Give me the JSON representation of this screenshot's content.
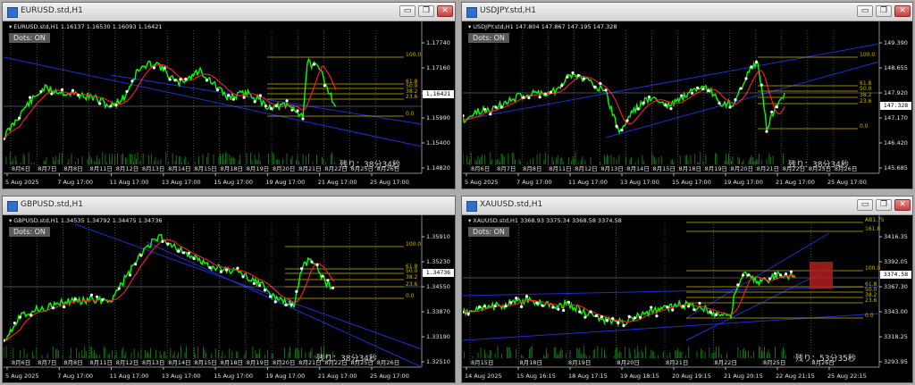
{
  "colors": {
    "candle_line": "#00ff00",
    "ma_line": "#ff2020",
    "trend_line": "#1c2fd6",
    "fib_line": "#c8b400",
    "dotted_grid": "#7a7a7a",
    "dots": "#ffffff"
  },
  "windows": [
    {
      "title": "EURUSD.std,H1",
      "info": "EURUSD.std,H1  1.16137 1.16530 1.16093 1.16421",
      "dots_label": "Dots: ON",
      "remaining": "残り：38分34秒",
      "price_current": "1.16421",
      "y_ticks": [
        "1.17740",
        "1.17160",
        "1.16570",
        "1.15990",
        "1.15400",
        "1.14820"
      ],
      "fib_labels": [
        "100.0",
        "61.8",
        "50.0",
        "38.2",
        "23.6",
        "0.0"
      ],
      "date_labels": [
        "8月6日",
        "8月7日",
        "8月8日",
        "8月11日",
        "8月12日",
        "8月13日",
        "8月14日",
        "8月15日",
        "8月18日",
        "8月19日",
        "8月20日",
        "8月21日",
        "8月22日",
        "8月25日",
        "8月26日"
      ],
      "x_ticks": [
        "5 Aug 2025",
        "7 Aug 17:00",
        "11 Aug 17:00",
        "13 Aug 17:00",
        "15 Aug 17:00",
        "19 Aug 17:00",
        "21 Aug 17:00",
        "25 Aug 17:00"
      ]
    },
    {
      "title": "USDJPY.std,H1",
      "info": "USDJPY.std,H1  147.804 147.867 147.195 147.328",
      "dots_label": "Dots: ON",
      "remaining": "残り：38分34秒",
      "price_current": "147.328",
      "y_ticks": [
        "149.390",
        "148.655",
        "147.920",
        "147.170",
        "146.420",
        "145.685"
      ],
      "fib_labels": [
        "100.0",
        "61.8",
        "50.0",
        "38.2",
        "23.6",
        "0.0"
      ],
      "date_labels": [
        "8月6日",
        "8月7日",
        "8月8日",
        "8月11日",
        "8月12日",
        "8月13日",
        "8月14日",
        "8月15日",
        "8月18日",
        "8月19日",
        "8月20日",
        "8月21日",
        "8月22日",
        "8月25日",
        "8月26日"
      ],
      "x_ticks": [
        "5 Aug 2025",
        "7 Aug 17:00",
        "11 Aug 17:00",
        "13 Aug 17:00",
        "15 Aug 17:00",
        "19 Aug 17:00",
        "21 Aug 17:00",
        "25 Aug 17:00"
      ]
    },
    {
      "title": "GBPUSD.std,H1",
      "info": "GBPUSD.std,H1  1.34535 1.34792 1.34475 1.34736",
      "dots_label": "Dots: ON",
      "remaining": "残り：38分34秒",
      "price_current": "1.34736",
      "y_ticks": [
        "1.35910",
        "1.35230",
        "1.34550",
        "1.33870",
        "1.33190",
        "1.32510"
      ],
      "fib_labels": [
        "100.0",
        "61.8",
        "50.0",
        "38.2",
        "23.6",
        "0.0"
      ],
      "date_labels": [
        "8月6日",
        "8月7日",
        "8月8日",
        "8月11日",
        "8月12日",
        "8月13日",
        "8月14日",
        "8月15日",
        "8月18日",
        "8月19日",
        "8月20日",
        "8月21日",
        "8月22日",
        "8月25日",
        "8月26日"
      ],
      "x_ticks": [
        "5 Aug 2025",
        "7 Aug 17:00",
        "11 Aug 17:00",
        "13 Aug 17:00",
        "15 Aug 17:00",
        "19 Aug 17:00",
        "21 Aug 17:00",
        "25 Aug 17:00"
      ]
    },
    {
      "title": "XAUUSD.std,H1",
      "info": "XAUUSD.std,H1  3368.93 3375.34 3368.58 3374.58",
      "dots_label": "Dots: ON",
      "remaining": "残り：53分35秒",
      "price_current": "3374.58",
      "y_ticks": [
        "3416.35",
        "3392.05",
        "3367.30",
        "3343.00",
        "3318.25",
        "3293.95"
      ],
      "fib_labels": [
        "AB1.75",
        "161.8",
        "100.0",
        "61.8",
        "50.0",
        "38.2",
        "23.6",
        "0.0"
      ],
      "date_labels": [
        "8月15日",
        "8月18日",
        "8月19日",
        "8月20日",
        "8月21日",
        "8月22日",
        "8月25日",
        "8月26日"
      ],
      "x_ticks": [
        "14 Aug 2025",
        "15 Aug 16:15",
        "18 Aug 17:15",
        "19 Aug 18:15",
        "20 Aug 19:15",
        "21 Aug 20:15",
        "22 Aug 21:15",
        "25 Aug 22:15"
      ]
    }
  ]
}
